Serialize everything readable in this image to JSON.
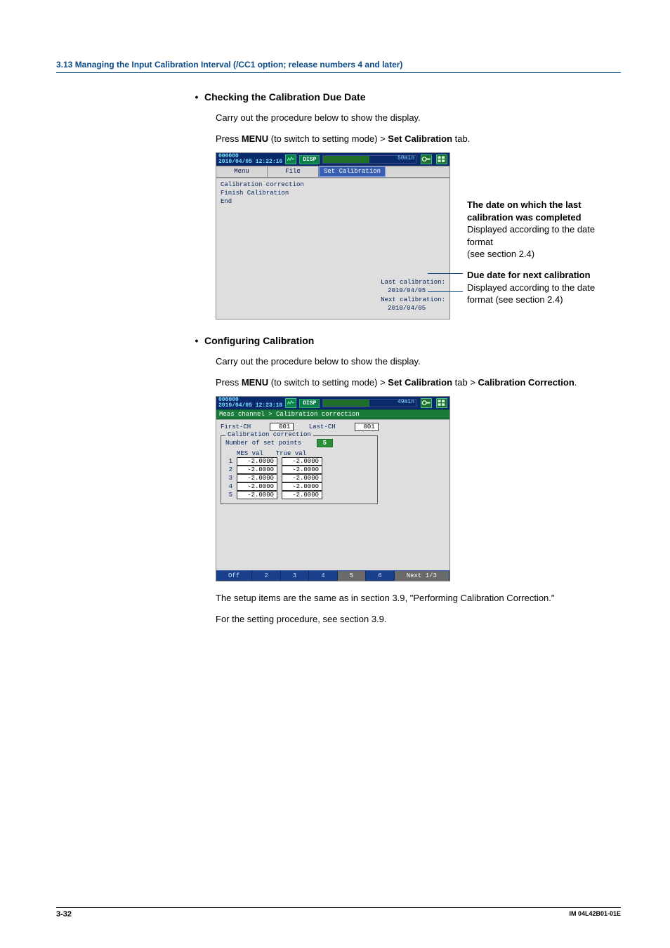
{
  "section_header": "3.13  Managing the Input Calibration Interval (/CC1 option; release numbers 4 and later)",
  "dot": "•",
  "h1": "Checking the Calibration Due Date",
  "p1": "Carry out the procedure below to show the display.",
  "p2a": "Press ",
  "p2b": "MENU",
  "p2c": " (to switch to setting mode) > ",
  "p2d": "Set Calibration",
  "p2e": " tab.",
  "screen1": {
    "stamp_top": "000000",
    "stamp_bot": "2010/04/05 12:22:16",
    "disp": "DISP",
    "bar_label": "50min",
    "tabs": {
      "menu": "Menu",
      "file": "File",
      "setcal": "Set Calibration"
    },
    "menu_items": [
      "Calibration correction",
      "Finish Calibration",
      "End"
    ],
    "last_lbl": "Last calibration:",
    "last_val": "2010/04/05",
    "next_lbl": "Next calibration:",
    "next_val": "2010/04/05"
  },
  "annot1_b": "The date on which the last calibration was completed",
  "annot1_t1": "Displayed according to the date format",
  "annot1_t2": "(see section 2.4)",
  "annot2_b": "Due date for next calibration",
  "annot2_t": "Displayed according to the date format (see section 2.4)",
  "h2": "Configuring Calibration",
  "p3": "Carry out the procedure below to show the display.",
  "p4a": "Press ",
  "p4b": "MENU",
  "p4c": " (to switch to setting mode) > ",
  "p4d": "Set Calibration",
  "p4e": " tab > ",
  "p4f": "Calibration Correction",
  "p4g": ".",
  "screen2": {
    "stamp_top": "000000",
    "stamp_bot": "2010/04/05 12:23:18",
    "disp": "DISP",
    "bar_label": "49min",
    "crumb": "Meas channel > Calibration correction",
    "first_ch_lbl": "First-CH",
    "first_ch_val": "001",
    "last_ch_lbl": "Last-CH",
    "last_ch_val": "001",
    "group": "Calibration correction",
    "num_pts_lbl": "Number of set points",
    "num_pts_val": "5",
    "hdr_mes": "MES val",
    "hdr_true": "True val",
    "rows": [
      {
        "i": "1",
        "mes": "-2.0000",
        "tru": "-2.0000"
      },
      {
        "i": "2",
        "mes": "-2.0000",
        "tru": "-2.0000"
      },
      {
        "i": "3",
        "mes": "-2.0000",
        "tru": "-2.0000"
      },
      {
        "i": "4",
        "mes": "-2.0000",
        "tru": "-2.0000"
      },
      {
        "i": "5",
        "mes": "-2.0000",
        "tru": "-2.0000"
      }
    ],
    "softkeys": [
      "Off",
      "2",
      "3",
      "4",
      "5",
      "6",
      "Next 1/3"
    ]
  },
  "p5": "The setup items are the same as in section 3.9, \"Performing Calibration Correction.\"",
  "p6": "For the setting procedure, see section 3.9.",
  "page_no": "3-32",
  "doc_no": "IM 04L42B01-01E"
}
